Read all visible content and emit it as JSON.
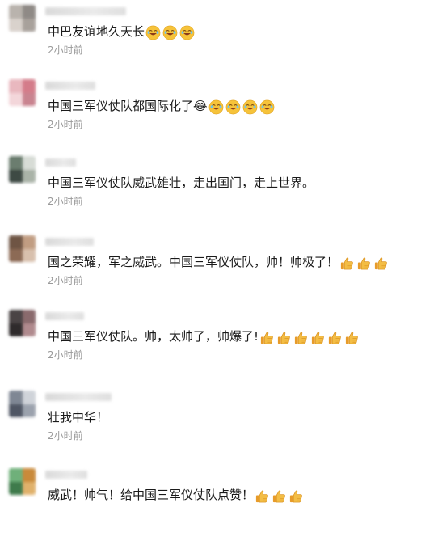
{
  "comments": [
    {
      "text": "中巴友谊地久天长",
      "time": "2小时前",
      "emoji": "laughing-emoji",
      "emoji_count": 3,
      "avatar_colors": [
        "#b9b3ad",
        "#8f8a86",
        "#d9d2cc",
        "#a8a19b"
      ]
    },
    {
      "text": "中国三军仪仗队都国际化了😂",
      "time": "2小时前",
      "emoji": "laughing-emoji",
      "emoji_count": 4,
      "avatar_colors": [
        "#e9b8bf",
        "#d47c8a",
        "#f3d6da",
        "#c98490"
      ]
    },
    {
      "text": "中国三军仪仗队威武雄壮，走出国门，走上世界。",
      "time": "2小时前",
      "emoji": "",
      "emoji_count": 0,
      "avatar_colors": [
        "#6b7d6f",
        "#d7dcd6",
        "#3e4a44",
        "#aab3a8"
      ]
    },
    {
      "text": "国之荣耀，军之威武。中国三军仪仗队，帅！帅极了！",
      "time": "2小时前",
      "emoji": "thumbs-up-emoji",
      "emoji_count": 3,
      "avatar_colors": [
        "#6f5544",
        "#c19d82",
        "#8c6a55",
        "#d8c0ad"
      ]
    },
    {
      "text": "中国三军仪仗队。帅，太帅了，帅爆了!",
      "time": "2小时前",
      "emoji": "thumbs-up-emoji",
      "emoji_count": 6,
      "avatar_colors": [
        "#4a4445",
        "#8a6a6d",
        "#2f2b2c",
        "#b08a8e"
      ]
    },
    {
      "text": "壮我中华！",
      "time": "2小时前",
      "emoji": "",
      "emoji_count": 0,
      "avatar_colors": [
        "#7f8794",
        "#cfd3d9",
        "#4f5664",
        "#9ba2ad"
      ]
    },
    {
      "text": "威武！帅气！给中国三军仪仗队点赞！",
      "time": "",
      "emoji": "thumbs-up-emoji",
      "emoji_count": 3,
      "avatar_colors": [
        "#6fb07a",
        "#c98a3a",
        "#3f7b4c",
        "#e0b16b"
      ]
    }
  ],
  "colors": {
    "text": "#1a1a1a",
    "time": "#9a9a9a",
    "emoji_yellow": "#f6c33a",
    "thumb_yellow": "#f0b33c"
  }
}
